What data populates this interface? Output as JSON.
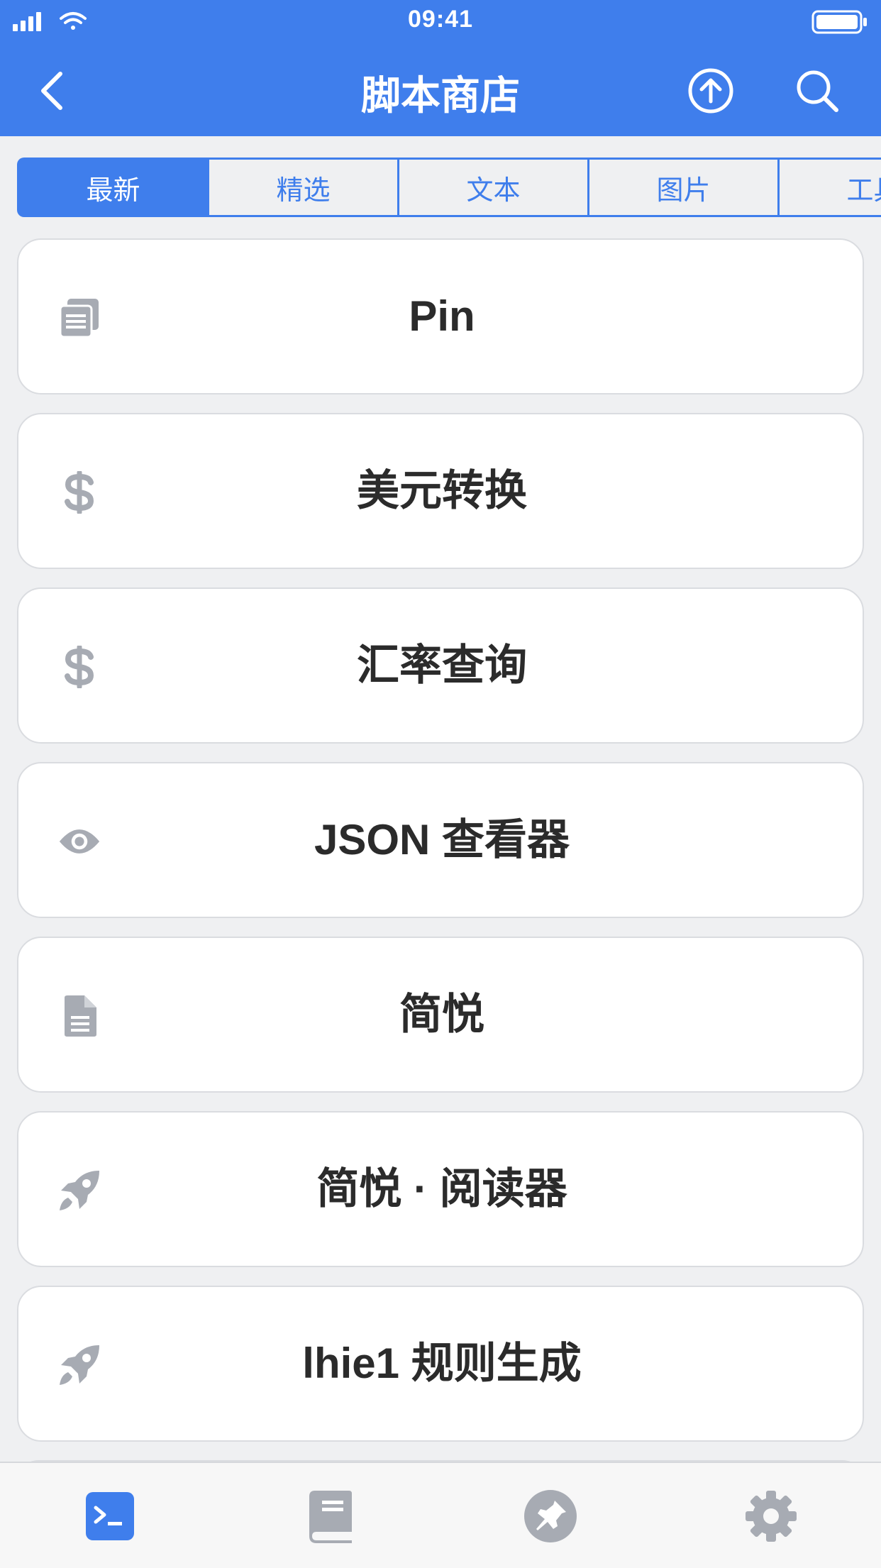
{
  "status_bar": {
    "time": "09:41"
  },
  "nav": {
    "title": "脚本商店",
    "back_icon": "chevron-left-icon",
    "upload_icon": "upload-circle-icon",
    "search_icon": "search-icon"
  },
  "tabs": [
    {
      "label": "最新",
      "active": true
    },
    {
      "label": "精选",
      "active": false
    },
    {
      "label": "文本",
      "active": false
    },
    {
      "label": "图片",
      "active": false
    },
    {
      "label": "工具",
      "active": false
    }
  ],
  "scripts": [
    {
      "title": "Pin",
      "icon": "clipboard-copy-icon"
    },
    {
      "title": "美元转换",
      "icon": "dollar-icon"
    },
    {
      "title": "汇率查询",
      "icon": "dollar-icon"
    },
    {
      "title": "JSON 查看器",
      "icon": "eye-icon"
    },
    {
      "title": "简悦",
      "icon": "document-icon"
    },
    {
      "title": "简悦 · 阅读器",
      "icon": "rocket-icon"
    },
    {
      "title": "lhie1 规则生成",
      "icon": "rocket-icon"
    }
  ],
  "bottom_tabs": [
    {
      "name": "terminal-icon",
      "active": true
    },
    {
      "name": "book-icon",
      "active": false
    },
    {
      "name": "pin-icon",
      "active": false
    },
    {
      "name": "gear-icon",
      "active": false
    }
  ],
  "colors": {
    "accent": "#3F7EEC",
    "background": "#EFF0F2",
    "icon_gray": "#A7ABB3",
    "text": "#2B2B2B"
  }
}
